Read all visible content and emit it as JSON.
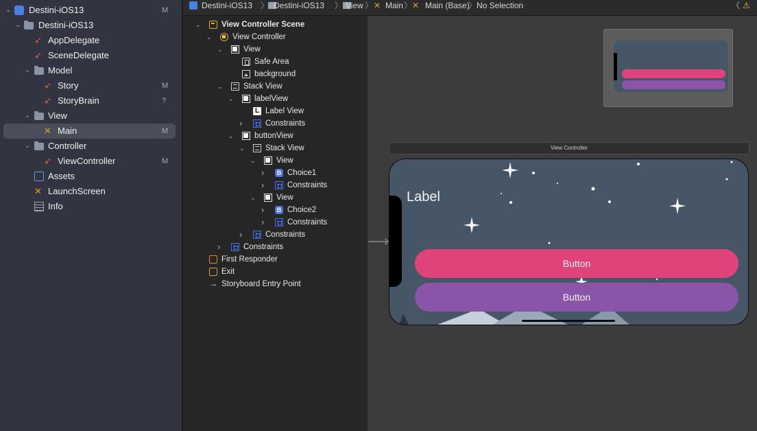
{
  "navigator": {
    "items": [
      {
        "label": "Destini-iOS13",
        "badge": "M",
        "icon": "project-icon",
        "arrow": "open"
      },
      {
        "label": "Destini-iOS13",
        "badge": "",
        "icon": "folder-icon",
        "arrow": "open"
      },
      {
        "label": "AppDelegate",
        "badge": "",
        "icon": "swift-icon",
        "arrow": ""
      },
      {
        "label": "SceneDelegate",
        "badge": "",
        "icon": "swift-icon",
        "arrow": ""
      },
      {
        "label": "Model",
        "badge": "",
        "icon": "folder-icon",
        "arrow": "open"
      },
      {
        "label": "Story",
        "badge": "M",
        "icon": "swift-icon",
        "arrow": ""
      },
      {
        "label": "StoryBrain",
        "badge": "?",
        "icon": "swift-icon",
        "arrow": ""
      },
      {
        "label": "View",
        "badge": "",
        "icon": "folder-icon",
        "arrow": "open"
      },
      {
        "label": "Main",
        "badge": "M",
        "icon": "storyboard-icon",
        "arrow": "",
        "selected": true
      },
      {
        "label": "Controller",
        "badge": "",
        "icon": "folder-icon",
        "arrow": "open"
      },
      {
        "label": "ViewController",
        "badge": "M",
        "icon": "swift-icon",
        "arrow": ""
      },
      {
        "label": "Assets",
        "badge": "",
        "icon": "assets-icon",
        "arrow": ""
      },
      {
        "label": "LaunchScreen",
        "badge": "",
        "icon": "storyboard-icon",
        "arrow": ""
      },
      {
        "label": "Info",
        "badge": "",
        "icon": "plist-icon",
        "arrow": ""
      }
    ]
  },
  "breadcrumb": {
    "items": [
      "Destini-iOS13",
      "Destini-iOS13",
      "View",
      "Main",
      "Main (Base)",
      "No Selection"
    ]
  },
  "outline": {
    "items": [
      {
        "label": "View Controller Scene",
        "icon": "scene",
        "arrow": "open",
        "bold": true
      },
      {
        "label": "View Controller",
        "icon": "vc",
        "arrow": "open"
      },
      {
        "label": "View",
        "icon": "view",
        "arrow": "open"
      },
      {
        "label": "Safe Area",
        "icon": "safe",
        "arrow": ""
      },
      {
        "label": "background",
        "icon": "img",
        "arrow": ""
      },
      {
        "label": "Stack View",
        "icon": "stack",
        "arrow": "open"
      },
      {
        "label": "labelView",
        "icon": "view",
        "arrow": "open"
      },
      {
        "label": "Label View",
        "icon": "label",
        "arrow": ""
      },
      {
        "label": "Constraints",
        "icon": "cons",
        "arrow": "closed"
      },
      {
        "label": "buttonView",
        "icon": "view",
        "arrow": "open"
      },
      {
        "label": "Stack View",
        "icon": "stack",
        "arrow": "open"
      },
      {
        "label": "View",
        "icon": "view",
        "arrow": "open"
      },
      {
        "label": "Choice1",
        "icon": "btn",
        "arrow": "closed"
      },
      {
        "label": "Constraints",
        "icon": "cons",
        "arrow": "closed"
      },
      {
        "label": "View",
        "icon": "view",
        "arrow": "open"
      },
      {
        "label": "Choice2",
        "icon": "btn",
        "arrow": "closed"
      },
      {
        "label": "Constraints",
        "icon": "cons",
        "arrow": "closed"
      },
      {
        "label": "Constraints",
        "icon": "cons",
        "arrow": "closed"
      },
      {
        "label": "Constraints",
        "icon": "cons",
        "arrow": "closed"
      },
      {
        "label": "First Responder",
        "icon": "fr",
        "arrow": ""
      },
      {
        "label": "Exit",
        "icon": "exit",
        "arrow": ""
      },
      {
        "label": "Storyboard Entry Point",
        "icon": "entry",
        "arrow": ""
      }
    ]
  },
  "canvas": {
    "scene_title": "View Controller",
    "label_text": "Label",
    "button1": "Button",
    "button2": "Button",
    "colors": {
      "button1": "#e0437a",
      "button2": "#8a54a8",
      "sky": "#475666"
    }
  }
}
